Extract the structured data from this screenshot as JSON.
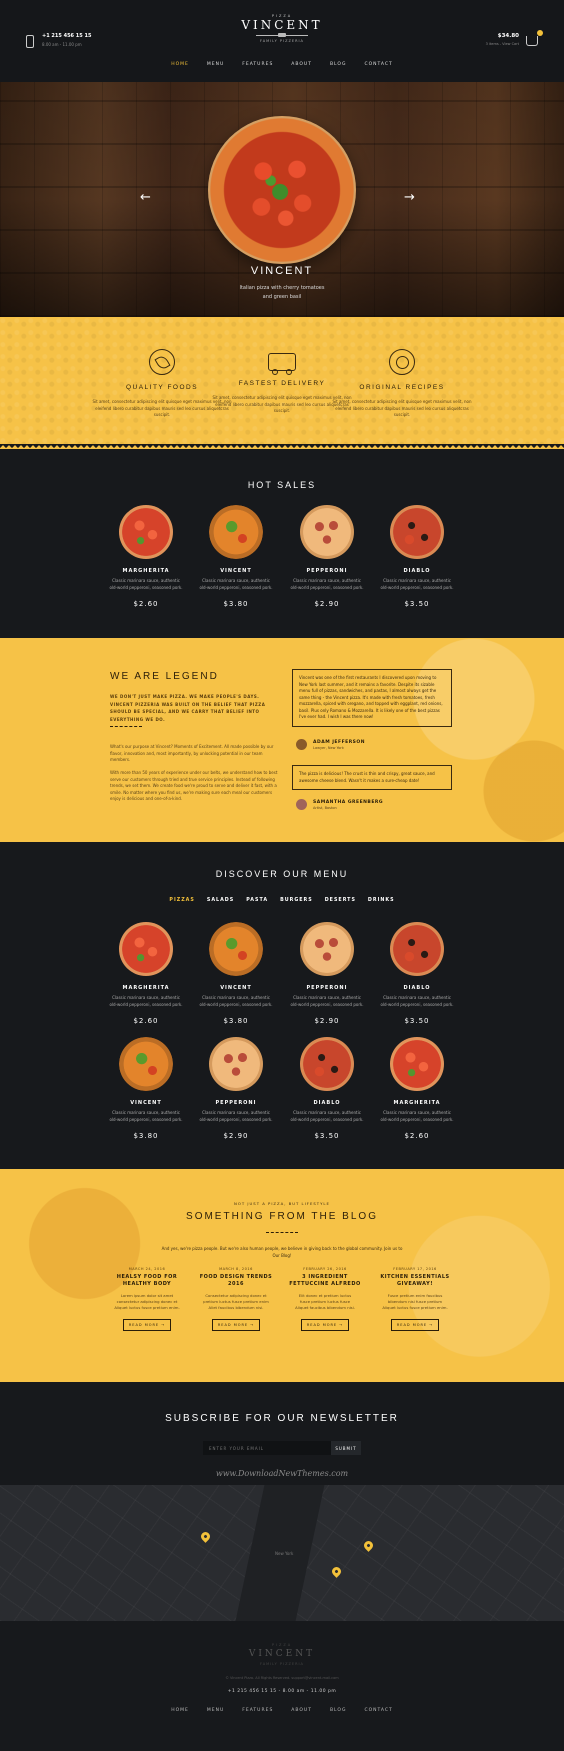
{
  "header": {
    "phone": "+1 215 456 15 15",
    "hours": "8.00 am - 11.00 pm",
    "logo_top": "PIZZA",
    "logo_name": "VINCENT",
    "logo_tag": "FAMILY PIZZERIA",
    "cart_total": "$34.80",
    "cart_sub": "3 items - View Cart",
    "nav": [
      "HOME",
      "MENU",
      "FEATURES",
      "ABOUT",
      "BLOG",
      "CONTACT"
    ]
  },
  "hero": {
    "title": "VINCENT",
    "subtitle_1": "Italian pizza with cherry tomatoes",
    "subtitle_2": "and green basil",
    "prev": "←",
    "next": "→"
  },
  "features": [
    {
      "title": "QUALITY FOODS",
      "text": "Sit amet, consectetur adipiscing elit quisque eget maximus velit, non eleifend libero curabitur dapibus mauris sed leo cursus aliquetcras suscipit."
    },
    {
      "title": "FASTEST DELIVERY",
      "text": "Sit amet, consectetur adipiscing elit quisque eget maximus velit, non eleifend libero curabitur dapibus mauris sed leo cursus aliquetcras suscipit."
    },
    {
      "title": "ORIGINAL RECIPES",
      "text": "Sit amet, consectetur adipiscing elit quisque eget maximus velit, non eleifend libero curabitur dapibus mauris sed leo cursus aliquetcras suscipit."
    }
  ],
  "hot_sales": {
    "title": "HOT SALES",
    "items": [
      {
        "name": "MARGHERITA",
        "desc1": "Classic marinara sauce, authentic",
        "desc2": "old-world pepperoni, seasoned pork.",
        "price": "$2.60"
      },
      {
        "name": "VINCENT",
        "desc1": "Classic marinara sauce, authentic",
        "desc2": "old-world pepperoni, seasoned pork.",
        "price": "$3.80"
      },
      {
        "name": "PEPPERONI",
        "desc1": "Classic marinara sauce, authentic",
        "desc2": "old-world pepperoni, seasoned pork.",
        "price": "$2.90"
      },
      {
        "name": "DIABLO",
        "desc1": "Classic marinara sauce, authentic",
        "desc2": "old-world pepperoni, seasoned pork.",
        "price": "$3.50"
      }
    ]
  },
  "legend": {
    "title": "WE ARE LEGEND",
    "lead": "WE DON'T JUST MAKE PIZZA. WE MAKE PEOPLE'S DAYS. VINCENT PIZZERIA WAS BUILT ON THE BELIEF THAT PIZZA SHOULD BE SPECIAL, AND WE CARRY THAT BELIEF INTO EVERYTHING WE DO.",
    "para1": "What's our purpose at Vincent? Moments of Excitement. All made possible by our flavor, innovation and, most importantly, by unlocking potential in our team members.",
    "para2": "With more than 50 years of experience under our belts, we understand how to best serve our customers through tried and true service principles. Instead of following trends, we set them. We create food we're proud to serve and deliver it fast, with a smile. No matter where you find us, we're making sure each meal our customers enjoy is delicious and one-of-a-kind.",
    "quotes": [
      {
        "text": "Vincent was one of the first restaurants I discovered upon moving to New York last summer, and it remains a favorite. Despite its sizable menu full of pizzas, sandwiches, and pastas, I almost always get the same thing - the Vincent pizza. It's made with fresh tomatoes, fresh mozzarella, spiced with oregano, and topped with eggplant, red onions, basil. Plus only Romano & Mozzarella. It is likely one of the best pizzas I've ever had. I wish I was there now!",
        "author": "ADAM JEFFERSON",
        "role": "Lawyer, New York"
      },
      {
        "text": "The pizza is delicious! The crust is thin and crispy, great sauce, and awesome cheese blend. Wasn't it makes a sure-cheap date!",
        "author": "SAMANTHA GREENBERG",
        "role": "Artist, Boston"
      }
    ]
  },
  "menu": {
    "title": "DISCOVER OUR MENU",
    "tabs": [
      "PIZZAS",
      "SALADS",
      "PASTA",
      "BURGERS",
      "DESERTS",
      "DRINKS"
    ],
    "row1": [
      {
        "name": "MARGHERITA",
        "desc1": "Classic marinara sauce, authentic",
        "desc2": "old-world pepperoni, seasoned pork.",
        "price": "$2.60"
      },
      {
        "name": "VINCENT",
        "desc1": "Classic marinara sauce, authentic",
        "desc2": "old-world pepperoni, seasoned pork.",
        "price": "$3.80"
      },
      {
        "name": "PEPPERONI",
        "desc1": "Classic marinara sauce, authentic",
        "desc2": "old-world pepperoni, seasoned pork.",
        "price": "$2.90"
      },
      {
        "name": "DIABLO",
        "desc1": "Classic marinara sauce, authentic",
        "desc2": "old-world pepperoni, seasoned pork.",
        "price": "$3.50"
      }
    ],
    "row2": [
      {
        "name": "VINCENT",
        "desc1": "Classic marinara sauce, authentic",
        "desc2": "old-world pepperoni, seasoned pork.",
        "price": "$3.80"
      },
      {
        "name": "PEPPERONI",
        "desc1": "Classic marinara sauce, authentic",
        "desc2": "old-world pepperoni, seasoned pork.",
        "price": "$2.90"
      },
      {
        "name": "DIABLO",
        "desc1": "Classic marinara sauce, authentic",
        "desc2": "old-world pepperoni, seasoned pork.",
        "price": "$3.50"
      },
      {
        "name": "MARGHERITA",
        "desc1": "Classic marinara sauce, authentic",
        "desc2": "old-world pepperoni, seasoned pork.",
        "price": "$2.60"
      }
    ]
  },
  "blog": {
    "kicker": "NOT JUST A PIZZA, BUT LIFESTYLE",
    "title": "SOMETHING FROM THE BLOG",
    "intro": "And yes, we're pizza people. But we're also human people, we believe in giving back to the global community. Join us to Our Blog!",
    "posts": [
      {
        "date": "MARCH 24, 2016",
        "title1": "HEALSY FOOD FOR",
        "title2": "HEALTHY BODY",
        "excerpt1": "Lorem ipsum dolor sit amet",
        "excerpt2": "consectetur adipiscing donec et",
        "excerpt3": "Aliquet luctus fusce pretium enim.",
        "button": "READ MORE →"
      },
      {
        "date": "MARCH 8, 2016",
        "title1": "FOOD DESIGN TRENDS",
        "title2": "2016",
        "excerpt1": "Consectetur adipiscing donec et",
        "excerpt2": "pretium luctus fusce pretium enim",
        "excerpt3": "Aliet faucibus bibendum nisi.",
        "button": "READ MORE →"
      },
      {
        "date": "FEBRUARY 26, 2016",
        "title1": "3 INGREDIENT",
        "title2": "FETTUCCINE ALFREDO",
        "excerpt1": "Elit donec et pretium luctus",
        "excerpt2": "fusce pretium luctus fusce",
        "excerpt3": "Aliquet faucibus bibendum nisi.",
        "button": "READ MORE →"
      },
      {
        "date": "FEBRUARY 17, 2016",
        "title1": "KITCHEN ESSENTIALS",
        "title2": "GIVEAWAY!",
        "excerpt1": "Fusce pretium enim faucibus",
        "excerpt2": "bibendum nisi fusce pretium",
        "excerpt3": "Aliquet luctus fusce pretium enim.",
        "button": "READ MORE →"
      }
    ]
  },
  "newsletter": {
    "title": "SUBSCRIBE FOR OUR NEWSLETTER",
    "placeholder": "ENTER YOUR EMAIL",
    "button": "SUBMIT",
    "watermark": "www.DownloadNewThemes.com"
  },
  "map": {
    "city": "New York"
  },
  "footer": {
    "copyright": "© Vincent Pizza. All Rights Reserved. support@vincent-mail.com",
    "contact": "+1 215 456 15 15  -  8.00 am - 11.00 pm",
    "nav": [
      "HOME",
      "MENU",
      "FEATURES",
      "ABOUT",
      "BLOG",
      "CONTACT"
    ]
  }
}
